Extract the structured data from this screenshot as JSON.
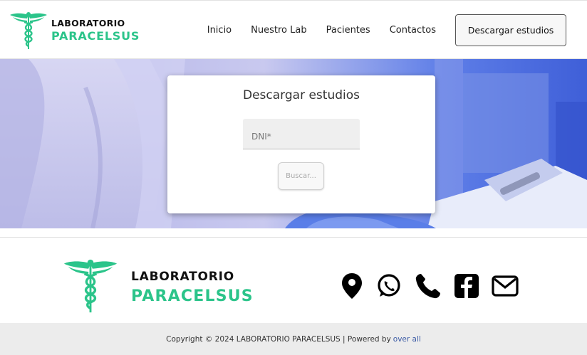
{
  "header": {
    "logo_line1": "LABORATORIO",
    "logo_line2": "PARACELSUS",
    "nav": [
      {
        "label": "Inicio"
      },
      {
        "label": "Nuestro Lab"
      },
      {
        "label": "Pacientes"
      },
      {
        "label": "Contactos"
      }
    ],
    "cta_label": "Descargar estudios"
  },
  "card": {
    "title": "Descargar estudios",
    "dni_placeholder": "DNI*",
    "button_label": "Buscar..."
  },
  "footer": {
    "logo_line1": "LABORATORIO",
    "logo_line2": "PARACELSUS",
    "socials": [
      "map-pin-icon",
      "whatsapp-icon",
      "phone-icon",
      "facebook-icon",
      "mail-icon"
    ],
    "copyright": "Copyright © 2024 LABORATORIO PARACELSUS | Powered by",
    "powered_link": "over all"
  },
  "colors": {
    "brand_green": "#2bc48a",
    "hero_tint": "#8c8ff0",
    "link_blue": "#3b5ba5"
  }
}
